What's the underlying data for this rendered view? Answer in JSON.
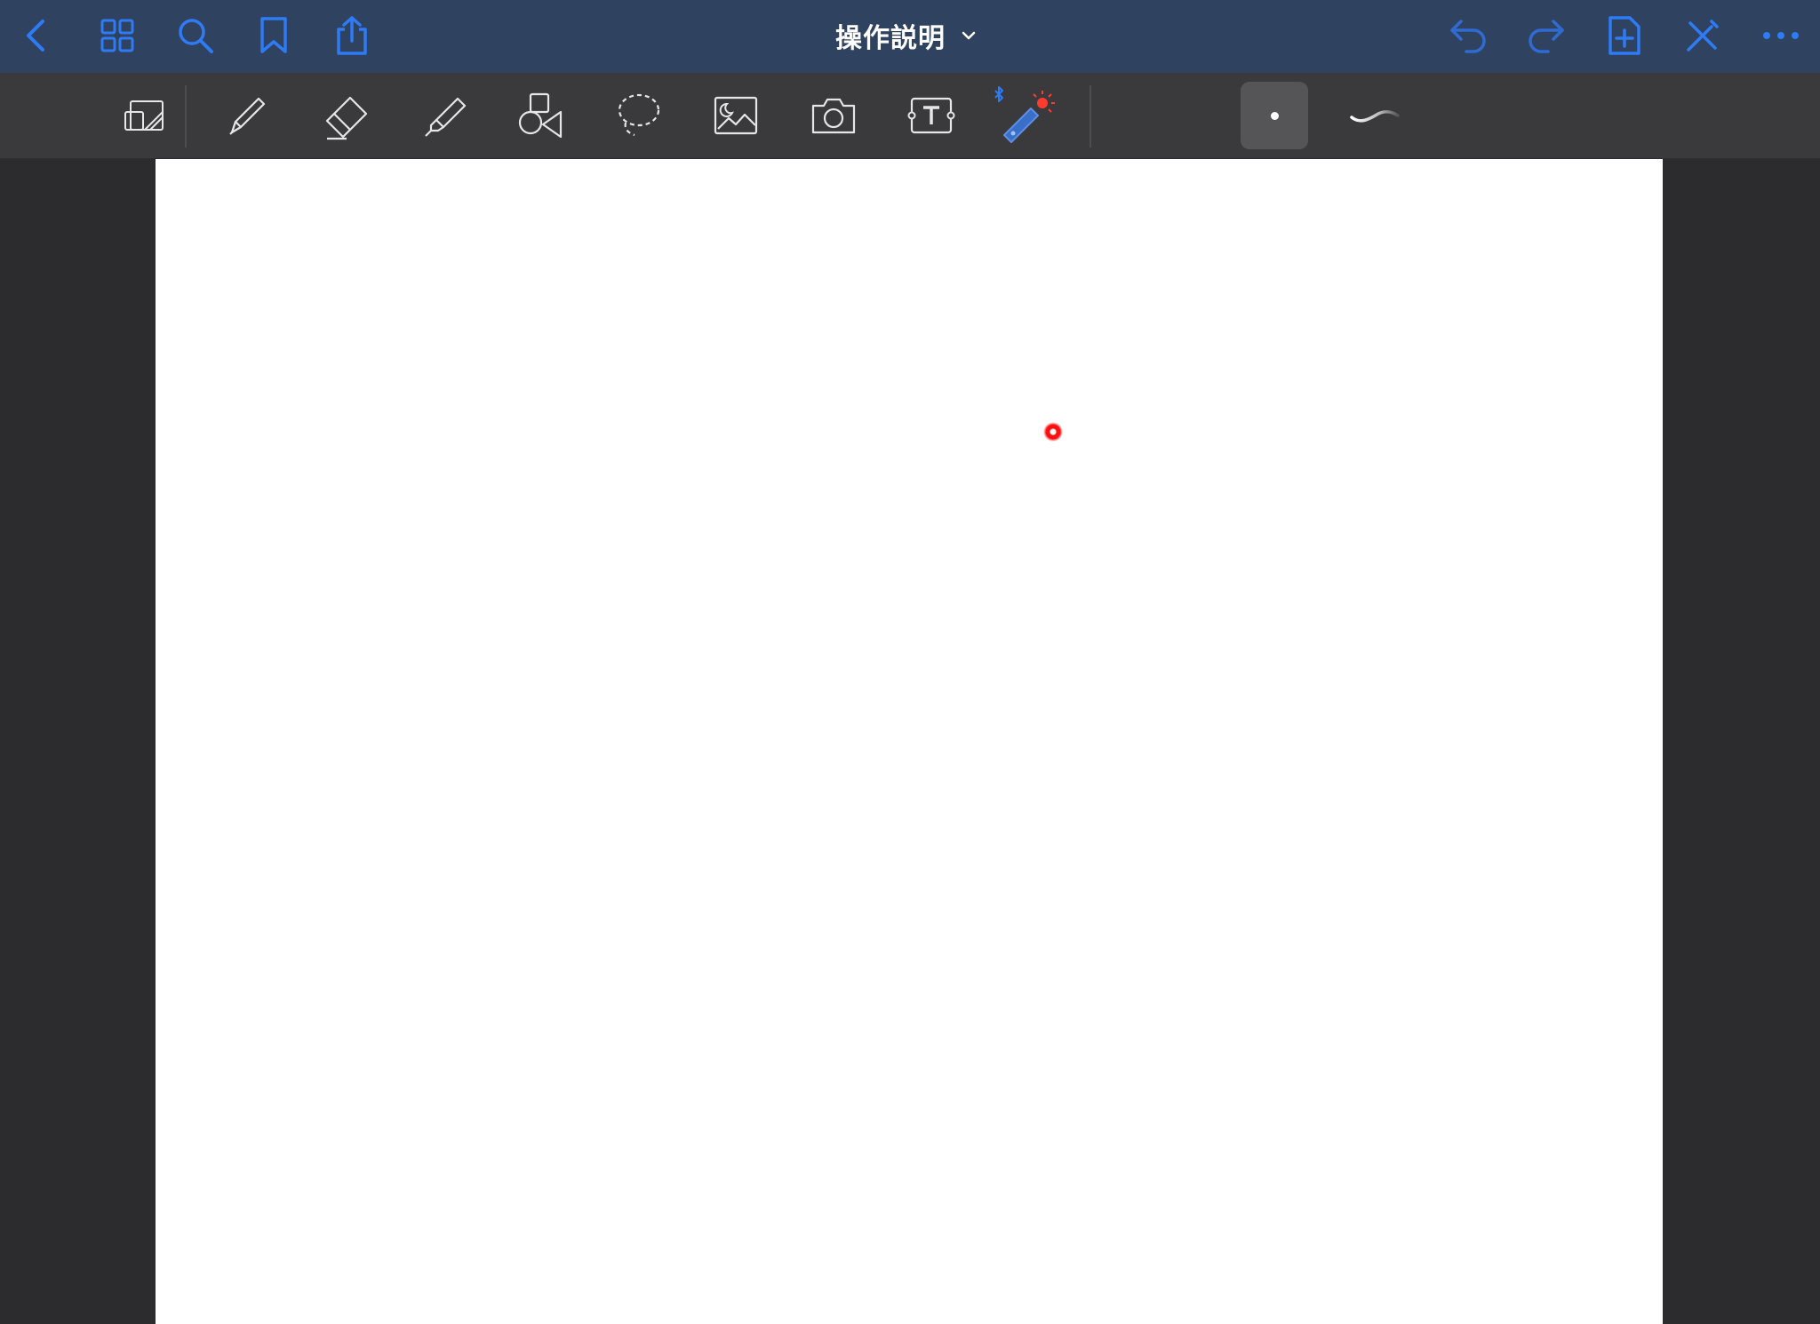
{
  "app": {
    "title": "操作説明",
    "accent_color": "#2f7bf5",
    "header_color": "#2f4260",
    "toolbar_color": "#3a3a3c",
    "laser_color": "#ff1010"
  },
  "header": {
    "left_icons": [
      "back-chevron-icon",
      "thumbnails-grid-icon",
      "search-icon",
      "bookmark-icon",
      "share-icon"
    ],
    "right_icons": [
      "undo-icon",
      "redo-icon",
      "add-page-icon",
      "read-only-pen-icon",
      "more-ellipsis-icon"
    ]
  },
  "toolbar": {
    "tools": [
      "zoom-window-icon",
      "pen-icon",
      "eraser-icon",
      "highlighter-icon",
      "shapes-icon",
      "lasso-icon",
      "image-icon",
      "camera-icon",
      "text-box-icon",
      "laser-pointer-icon"
    ],
    "selected_tool": "laser-pointer-icon",
    "options": [
      "laser-dot-option",
      "laser-trail-option"
    ],
    "selected_option": "laser-dot-option"
  }
}
